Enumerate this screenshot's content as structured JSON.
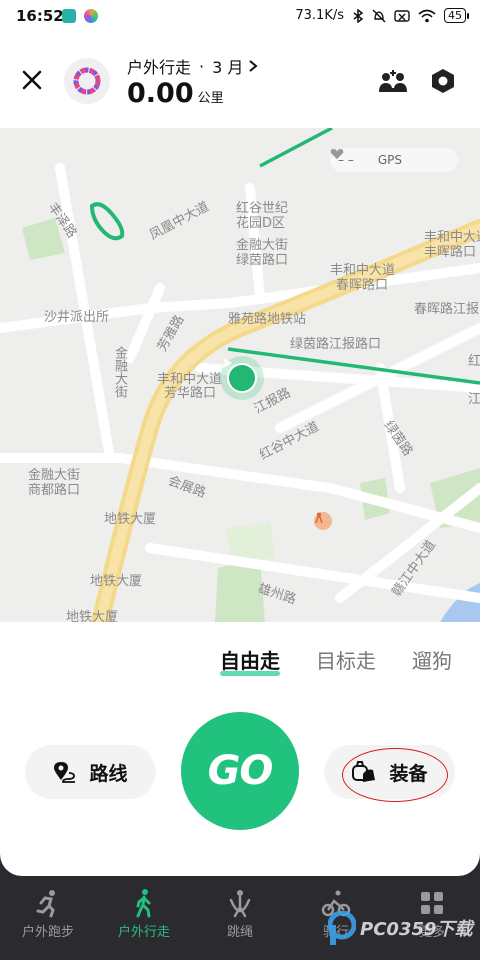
{
  "status_bar": {
    "time": "16:52",
    "net_speed": "73.1K/s",
    "battery": "45"
  },
  "header": {
    "title": "户外行走",
    "month": "3 月",
    "distance_value": "0.00",
    "distance_unit": "公里"
  },
  "map": {
    "heart_rate": "– –",
    "gps_label": "GPS",
    "labels": [
      "丰泽路",
      "凤凰中大道",
      "红谷世纪",
      "花园D区",
      "金融大街",
      "绿茵路口",
      "丰和中大道",
      "丰和中大道",
      "春晖路口",
      "丰晖路口",
      "春晖路江报",
      "沙井派出所",
      "芳雅路",
      "雅苑路地铁站",
      "绿茵路江报路口",
      "丰和中大道",
      "芳华路口",
      "江报路",
      "金融大街",
      "红谷中大道",
      "绿茵路",
      "会展路",
      "金融大街",
      "商都路口",
      "地铁大厦",
      "地铁大厦",
      "地铁大厦",
      "雄州路",
      "赣江中大道",
      "红",
      "江"
    ]
  },
  "modes": {
    "items": [
      "自由走",
      "目标走",
      "遛狗"
    ],
    "active": "自由走"
  },
  "actions": {
    "route_label": "路线",
    "go_label": "GO",
    "gear_label": "装备"
  },
  "nav": {
    "items": [
      {
        "label": "户外跑步"
      },
      {
        "label": "户外行走"
      },
      {
        "label": "跳绳"
      },
      {
        "label": "骑行"
      },
      {
        "label": "更多"
      }
    ],
    "active_index": 1
  },
  "colors": {
    "accent": "#21c27e",
    "map_bg": "#eeeeec",
    "major_road": "#f5d98a",
    "track": "#22b873",
    "annotation_ring": "#d81b1b"
  },
  "watermark": "PC0359下载"
}
